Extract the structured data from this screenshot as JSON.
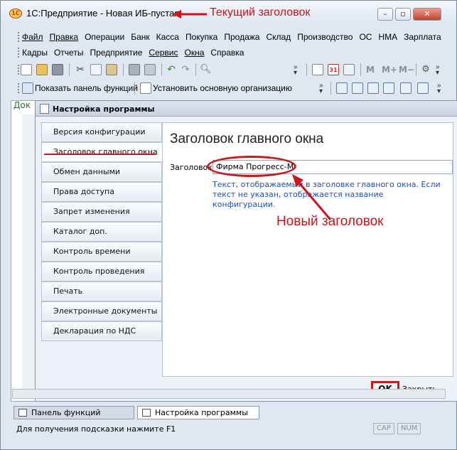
{
  "window": {
    "title": "1С:Предприятие - Новая ИБ-пустая",
    "logo": "1C"
  },
  "annotations": {
    "current_title": "Текущий заголовок",
    "new_title": "Новый заголовок",
    "color": "#d0101a"
  },
  "menu": {
    "row1": [
      "Файл",
      "Правка",
      "Операции",
      "Банк",
      "Касса",
      "Покупка",
      "Продажа",
      "Склад",
      "Производство",
      "ОС",
      "НМА",
      "Зарплата"
    ],
    "row2": [
      "Кадры",
      "Отчеты",
      "Предприятие",
      "Сервис",
      "Окна",
      "Справка"
    ]
  },
  "toolbar": {
    "show_functions_panel": "Показать панель функций",
    "set_main_org": "Установить основную организацию",
    "calendar_day": "31"
  },
  "background": {
    "tab_fragment": "Док"
  },
  "dialog": {
    "title": "Настройка программы",
    "nav": [
      "Версия конфигурации",
      "Заголовок главного окна",
      "Обмен данными",
      "Права доступа",
      "Запрет изменения данных",
      "Каталог доп. информации",
      "Контроль времени",
      "Контроль проведения",
      "Печать",
      "Электронные документы",
      "Декларация по НДС"
    ],
    "active_index": 1,
    "heading": "Заголовок главного окна",
    "field_label": "Заголовок:",
    "field_value": "Фирма Прогресс-М",
    "hint": "Текст, отображаемый в заголовке главного окна. Если текст не указан, отображается название конфигурации.",
    "ok_label": "OK",
    "close_label": "Закрыть"
  },
  "taskbar": {
    "tasks": [
      "Панель функций",
      "Настройка программы"
    ]
  },
  "status": {
    "hint": "Для получения подсказки нажмите F1",
    "caps": "CAP",
    "num": "NUM"
  }
}
